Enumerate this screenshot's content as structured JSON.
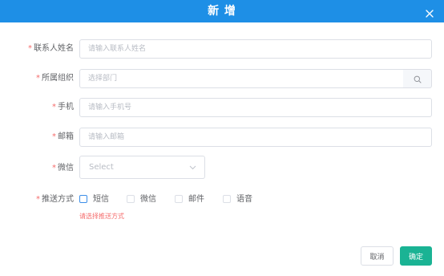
{
  "dialog": {
    "title": "新 增",
    "close_icon": "close-icon"
  },
  "form": {
    "contact_name": {
      "label": "联系人姓名",
      "placeholder": "请输入联系人姓名",
      "value": ""
    },
    "organization": {
      "label": "所属组织",
      "placeholder": "选择部门",
      "value": "",
      "search_icon": "search-icon"
    },
    "phone": {
      "label": "手机",
      "placeholder": "请输入手机号",
      "value": ""
    },
    "email": {
      "label": "邮箱",
      "placeholder": "请输入邮箱",
      "value": ""
    },
    "wechat": {
      "label": "微信",
      "placeholder": "Select",
      "value": ""
    },
    "push_method": {
      "label": "推送方式",
      "options": [
        {
          "label": "短信",
          "checked": false
        },
        {
          "label": "微信",
          "checked": false
        },
        {
          "label": "邮件",
          "checked": false
        },
        {
          "label": "语音",
          "checked": false
        }
      ],
      "error": "请选择推送方式"
    },
    "required_mark": "*"
  },
  "footer": {
    "cancel_label": "取消",
    "confirm_label": "确定"
  },
  "colors": {
    "header": "#1e8fe6",
    "confirm": "#1ab394",
    "required": "#f56c6c"
  }
}
